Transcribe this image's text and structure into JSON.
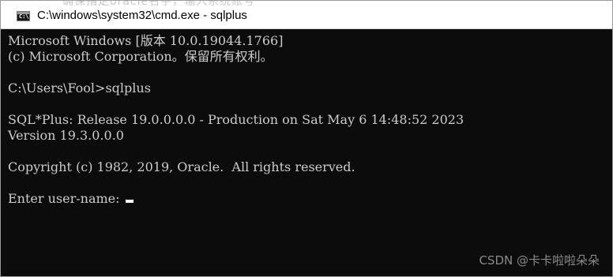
{
  "window": {
    "title": "C:\\windows\\system32\\cmd.exe - sqlplus",
    "icon_label": "C:\\",
    "icon": "cmd-icon",
    "background_snippet": "确保指定oracle名字，输入系统账号"
  },
  "console": {
    "lines": [
      "Microsoft Windows [版本 10.0.19044.1766]",
      "(c) Microsoft Corporation。保留所有权利。",
      "",
      "C:\\Users\\Fool>sqlplus",
      "",
      "SQL*Plus: Release 19.0.0.0.0 - Production on Sat May 6 14:48:52 2023",
      "Version 19.3.0.0.0",
      "",
      "Copyright (c) 1982, 2019, Oracle.  All rights reserved.",
      "",
      "Enter user-name: "
    ]
  },
  "watermark": "CSDN @卡卡啦啦朵朵",
  "colors": {
    "console_bg": "#0c0c0c",
    "console_text": "#cccccc",
    "titlebar_bg": "#ffffff"
  }
}
